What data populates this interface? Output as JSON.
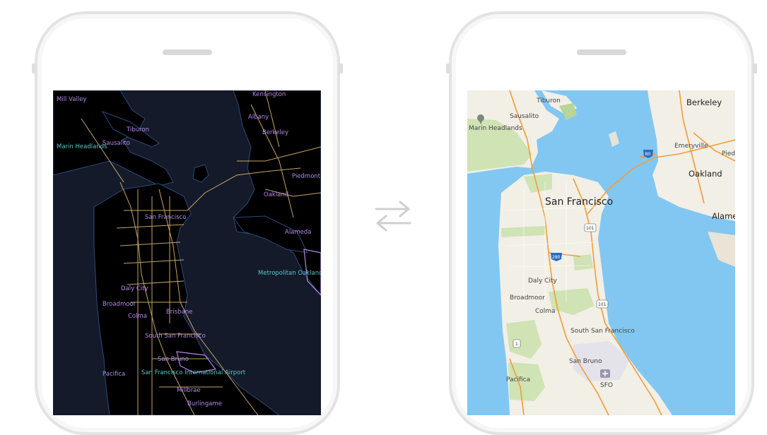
{
  "dark_map": {
    "labels": {
      "mill_valley": "Mill Valley",
      "tiburon": "Tiburon",
      "marin_headlands": "Marin Headlands",
      "sausalito": "Sausalito",
      "kensington": "Kensington",
      "albany": "Albany",
      "berkeley": "Berkeley",
      "piedmont": "Piedmont",
      "oakland": "Oakland",
      "alameda": "Alameda",
      "san_francisco": "San Francisco",
      "metropolitan_oakland": "Metropolitan Oakland In",
      "daly_city": "Daly City",
      "broadmoor": "Broadmoor",
      "colma": "Colma",
      "brisbane": "Brisbane",
      "south_san_francisco": "South San Francisco",
      "san_bruno": "San Bruno",
      "pacifica": "Pacifica",
      "sfo": "San Francisco International Airport",
      "millbrae": "Millbrae",
      "burlingame": "Burlingame"
    }
  },
  "light_map": {
    "labels": {
      "tiburon": "Tiburon",
      "sausalito": "Sausalito",
      "marin_headlands": "Marin Headlands",
      "berkeley": "Berkeley",
      "emeryville": "Emeryville",
      "piedmont": "Pied",
      "oakland": "Oakland",
      "alameda": "Alame",
      "san_francisco": "San Francisco",
      "daly_city": "Daly City",
      "broadmoor": "Broadmoor",
      "colma": "Colma",
      "south_san_francisco": "South San Francisco",
      "san_bruno": "San Bruno",
      "pacifica": "Pacifica",
      "sfo": "SFO"
    },
    "shields": {
      "i80": "80",
      "us101_a": "101",
      "i280": "280",
      "us101_b": "101",
      "ca1": "1"
    }
  },
  "colors": {
    "dark_bg": "#141a29",
    "dark_land": "#000000",
    "dark_road": "#e8c27a",
    "light_water": "#82c7f2",
    "light_land": "#f2efe6",
    "light_park": "#cfe3b4",
    "light_road": "#f29c38"
  }
}
